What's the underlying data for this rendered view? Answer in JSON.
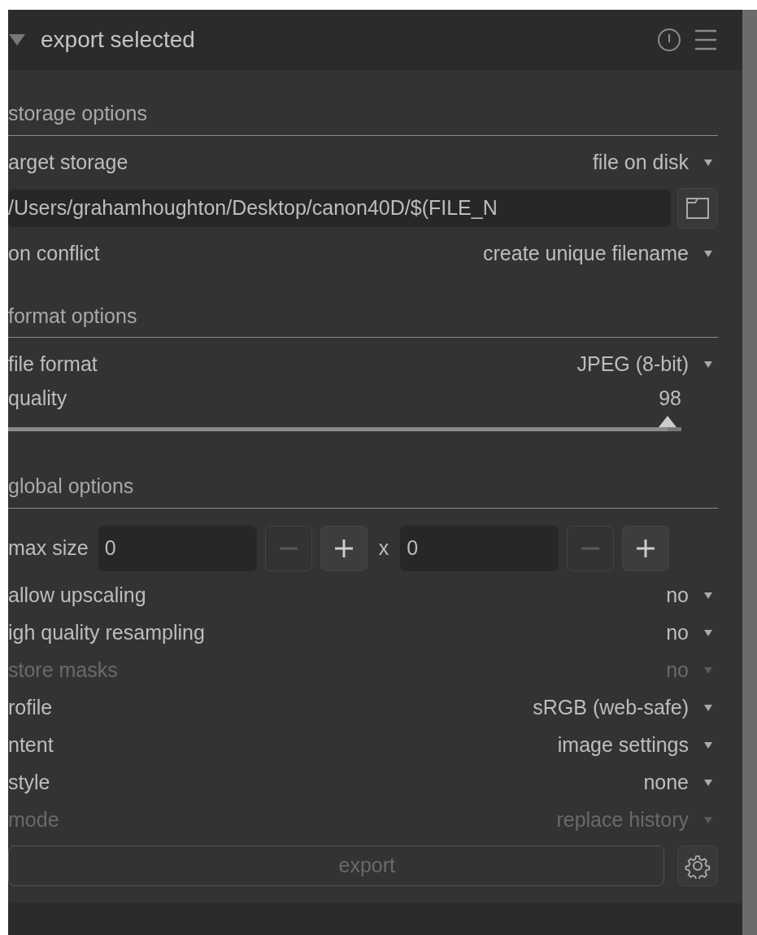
{
  "header": {
    "title": "export selected",
    "expanded": true
  },
  "sections": [
    {
      "title": "storage options",
      "rows": [
        {
          "kind": "combo",
          "label": "arget storage",
          "value": "file on disk",
          "disabled": false
        },
        {
          "kind": "path",
          "value": "/Users/grahamhoughton/Desktop/canon40D/$(FILE_N"
        },
        {
          "kind": "combo",
          "label": "on conflict",
          "value": "create unique filename",
          "disabled": false
        }
      ]
    },
    {
      "title": "format options",
      "rows": [
        {
          "kind": "combo",
          "label": "file format",
          "value": "JPEG (8-bit)",
          "disabled": false
        },
        {
          "kind": "slider",
          "label": "quality",
          "reading": "98",
          "level": 0.98
        }
      ]
    },
    {
      "title": "global options",
      "rows": [
        {
          "kind": "size",
          "label": "max size",
          "separator": "x",
          "fields": [
            {
              "value": "0",
              "decrease_disabled": true
            },
            {
              "value": "0",
              "decrease_disabled": true
            }
          ]
        },
        {
          "kind": "combo",
          "label": "allow upscaling",
          "value": "no",
          "disabled": false
        },
        {
          "kind": "combo",
          "label": "igh quality resampling",
          "value": "no",
          "disabled": false
        },
        {
          "kind": "combo",
          "label": "store masks",
          "value": "no",
          "disabled": true
        },
        {
          "kind": "combo",
          "label": "rofile",
          "value": "sRGB (web-safe)",
          "disabled": false
        },
        {
          "kind": "combo",
          "label": "ntent",
          "value": "image settings",
          "disabled": false
        },
        {
          "kind": "combo",
          "label": "style",
          "value": "none",
          "disabled": false
        },
        {
          "kind": "combo",
          "label": "mode",
          "value": "replace history",
          "disabled": true
        }
      ]
    }
  ],
  "export_button": {
    "label": "export",
    "disabled": true
  }
}
